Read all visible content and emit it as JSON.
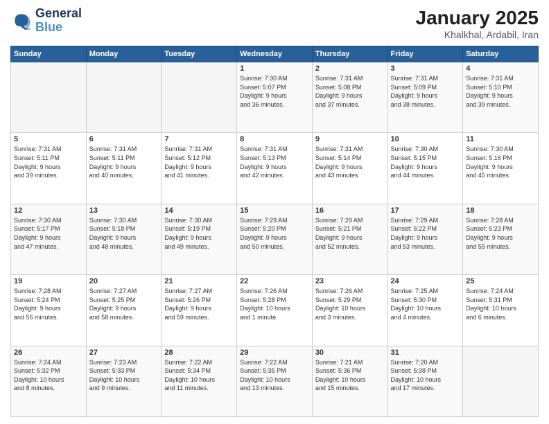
{
  "header": {
    "logo_line1": "General",
    "logo_line2": "Blue",
    "title": "January 2025",
    "subtitle": "Khalkhal, Ardabil, Iran"
  },
  "days_of_week": [
    "Sunday",
    "Monday",
    "Tuesday",
    "Wednesday",
    "Thursday",
    "Friday",
    "Saturday"
  ],
  "weeks": [
    [
      {
        "day": "",
        "info": ""
      },
      {
        "day": "",
        "info": ""
      },
      {
        "day": "",
        "info": ""
      },
      {
        "day": "1",
        "info": "Sunrise: 7:30 AM\nSunset: 5:07 PM\nDaylight: 9 hours\nand 36 minutes."
      },
      {
        "day": "2",
        "info": "Sunrise: 7:31 AM\nSunset: 5:08 PM\nDaylight: 9 hours\nand 37 minutes."
      },
      {
        "day": "3",
        "info": "Sunrise: 7:31 AM\nSunset: 5:09 PM\nDaylight: 9 hours\nand 38 minutes."
      },
      {
        "day": "4",
        "info": "Sunrise: 7:31 AM\nSunset: 5:10 PM\nDaylight: 9 hours\nand 39 minutes."
      }
    ],
    [
      {
        "day": "5",
        "info": "Sunrise: 7:31 AM\nSunset: 5:11 PM\nDaylight: 9 hours\nand 39 minutes."
      },
      {
        "day": "6",
        "info": "Sunrise: 7:31 AM\nSunset: 5:11 PM\nDaylight: 9 hours\nand 40 minutes."
      },
      {
        "day": "7",
        "info": "Sunrise: 7:31 AM\nSunset: 5:12 PM\nDaylight: 9 hours\nand 41 minutes."
      },
      {
        "day": "8",
        "info": "Sunrise: 7:31 AM\nSunset: 5:13 PM\nDaylight: 9 hours\nand 42 minutes."
      },
      {
        "day": "9",
        "info": "Sunrise: 7:31 AM\nSunset: 5:14 PM\nDaylight: 9 hours\nand 43 minutes."
      },
      {
        "day": "10",
        "info": "Sunrise: 7:30 AM\nSunset: 5:15 PM\nDaylight: 9 hours\nand 44 minutes."
      },
      {
        "day": "11",
        "info": "Sunrise: 7:30 AM\nSunset: 5:16 PM\nDaylight: 9 hours\nand 45 minutes."
      }
    ],
    [
      {
        "day": "12",
        "info": "Sunrise: 7:30 AM\nSunset: 5:17 PM\nDaylight: 9 hours\nand 47 minutes."
      },
      {
        "day": "13",
        "info": "Sunrise: 7:30 AM\nSunset: 5:18 PM\nDaylight: 9 hours\nand 48 minutes."
      },
      {
        "day": "14",
        "info": "Sunrise: 7:30 AM\nSunset: 5:19 PM\nDaylight: 9 hours\nand 49 minutes."
      },
      {
        "day": "15",
        "info": "Sunrise: 7:29 AM\nSunset: 5:20 PM\nDaylight: 9 hours\nand 50 minutes."
      },
      {
        "day": "16",
        "info": "Sunrise: 7:29 AM\nSunset: 5:21 PM\nDaylight: 9 hours\nand 52 minutes."
      },
      {
        "day": "17",
        "info": "Sunrise: 7:29 AM\nSunset: 5:22 PM\nDaylight: 9 hours\nand 53 minutes."
      },
      {
        "day": "18",
        "info": "Sunrise: 7:28 AM\nSunset: 5:23 PM\nDaylight: 9 hours\nand 55 minutes."
      }
    ],
    [
      {
        "day": "19",
        "info": "Sunrise: 7:28 AM\nSunset: 5:24 PM\nDaylight: 9 hours\nand 56 minutes."
      },
      {
        "day": "20",
        "info": "Sunrise: 7:27 AM\nSunset: 5:25 PM\nDaylight: 9 hours\nand 58 minutes."
      },
      {
        "day": "21",
        "info": "Sunrise: 7:27 AM\nSunset: 5:26 PM\nDaylight: 9 hours\nand 59 minutes."
      },
      {
        "day": "22",
        "info": "Sunrise: 7:26 AM\nSunset: 5:28 PM\nDaylight: 10 hours\nand 1 minute."
      },
      {
        "day": "23",
        "info": "Sunrise: 7:26 AM\nSunset: 5:29 PM\nDaylight: 10 hours\nand 3 minutes."
      },
      {
        "day": "24",
        "info": "Sunrise: 7:25 AM\nSunset: 5:30 PM\nDaylight: 10 hours\nand 4 minutes."
      },
      {
        "day": "25",
        "info": "Sunrise: 7:24 AM\nSunset: 5:31 PM\nDaylight: 10 hours\nand 6 minutes."
      }
    ],
    [
      {
        "day": "26",
        "info": "Sunrise: 7:24 AM\nSunset: 5:32 PM\nDaylight: 10 hours\nand 8 minutes."
      },
      {
        "day": "27",
        "info": "Sunrise: 7:23 AM\nSunset: 5:33 PM\nDaylight: 10 hours\nand 9 minutes."
      },
      {
        "day": "28",
        "info": "Sunrise: 7:22 AM\nSunset: 5:34 PM\nDaylight: 10 hours\nand 11 minutes."
      },
      {
        "day": "29",
        "info": "Sunrise: 7:22 AM\nSunset: 5:35 PM\nDaylight: 10 hours\nand 13 minutes."
      },
      {
        "day": "30",
        "info": "Sunrise: 7:21 AM\nSunset: 5:36 PM\nDaylight: 10 hours\nand 15 minutes."
      },
      {
        "day": "31",
        "info": "Sunrise: 7:20 AM\nSunset: 5:38 PM\nDaylight: 10 hours\nand 17 minutes."
      },
      {
        "day": "",
        "info": ""
      }
    ]
  ]
}
